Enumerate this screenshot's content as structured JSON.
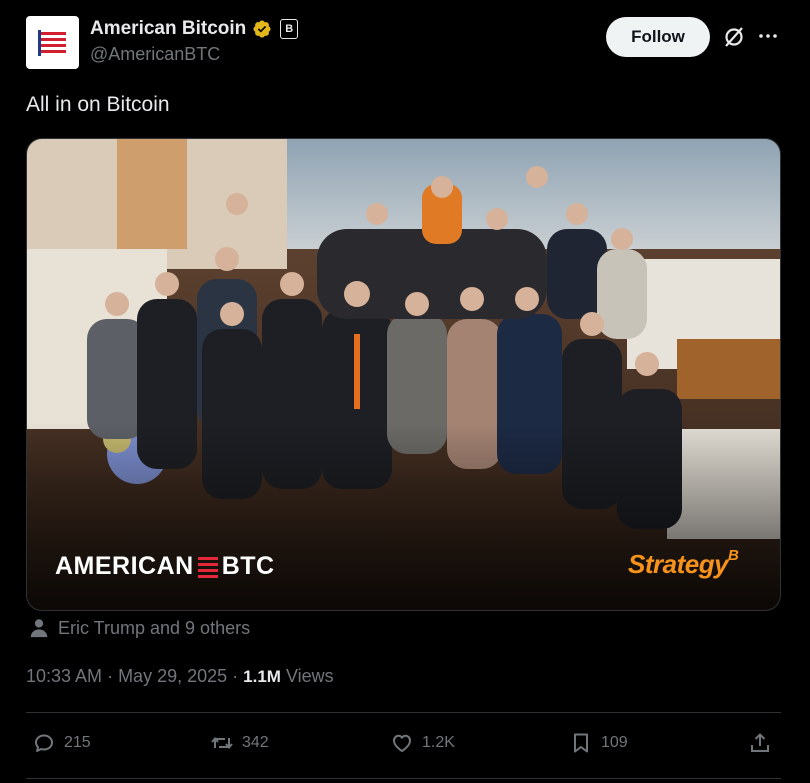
{
  "author": {
    "display_name": "American Bitcoin",
    "handle": "@AmericanBTC",
    "affiliate_badge": "B",
    "verified_badge_color": "#e2b719"
  },
  "header": {
    "follow_label": "Follow"
  },
  "tweet": {
    "text": "All in on Bitcoin"
  },
  "media": {
    "brand_left_a": "AMERICAN",
    "brand_left_b": "BTC",
    "brand_right": "Strategy",
    "brand_right_mark": "B"
  },
  "tagged": {
    "text": "Eric Trump and 9 others"
  },
  "meta": {
    "time": "10:33 AM",
    "sep1": "·",
    "date": "May 29, 2025",
    "sep2": "·",
    "views_count": "1.1M",
    "views_label": "Views"
  },
  "actions": {
    "replies": "215",
    "reposts": "342",
    "likes": "1.2K",
    "bookmarks": "109"
  },
  "colors": {
    "background": "#000000",
    "text_primary": "#e7e9ea",
    "text_secondary": "#71767b",
    "follow_bg": "#eff3f4",
    "strategy_orange": "#f7931a"
  }
}
